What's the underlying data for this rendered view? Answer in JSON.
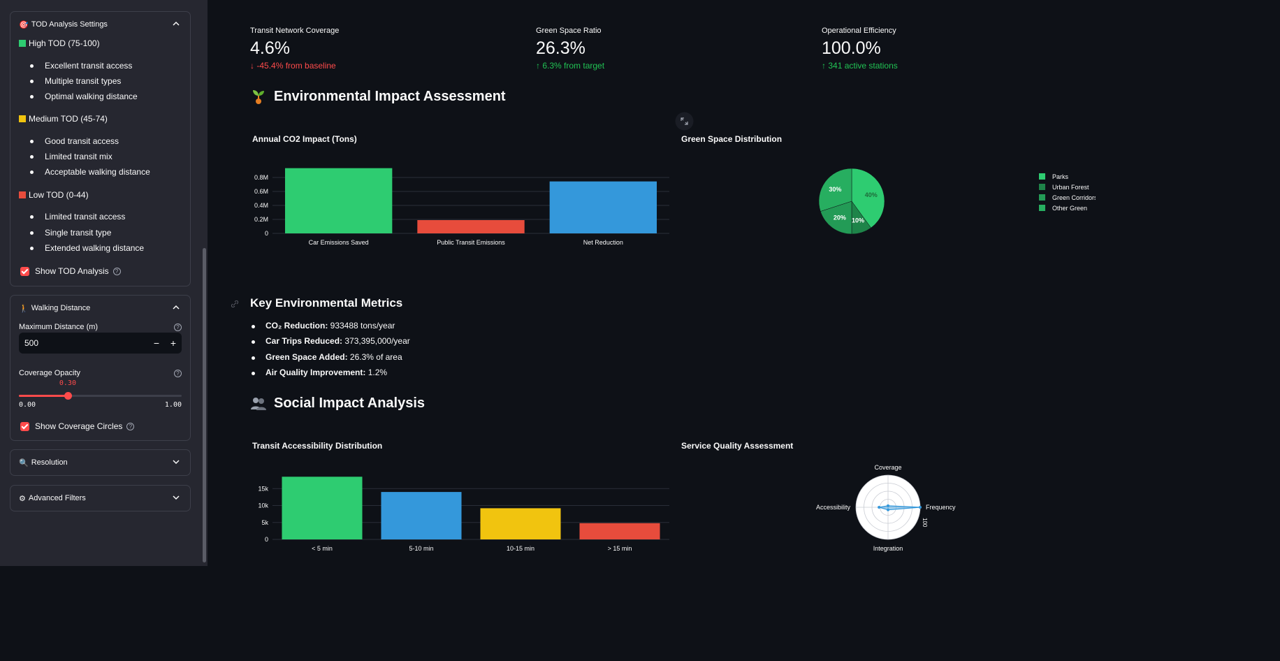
{
  "sidebar": {
    "tod_panel": {
      "title": "TOD Analysis Settings",
      "emoji": "🎯",
      "high": {
        "label": "High TOD (75-100)",
        "color": "#2ecc71",
        "items": [
          "Excellent transit access",
          "Multiple transit types",
          "Optimal walking distance"
        ]
      },
      "medium": {
        "label": "Medium TOD (45-74)",
        "color": "#f1c40f",
        "items": [
          "Good transit access",
          "Limited transit mix",
          "Acceptable walking distance"
        ]
      },
      "low": {
        "label": "Low TOD (0-44)",
        "color": "#e74c3c",
        "items": [
          "Limited transit access",
          "Single transit type",
          "Extended walking distance"
        ]
      },
      "show_checkbox": "Show TOD Analysis"
    },
    "walk_panel": {
      "title": "Walking Distance",
      "emoji": "🚶",
      "max_label": "Maximum Distance (m)",
      "max_value": "500",
      "minus": "−",
      "plus": "+",
      "opacity_label": "Coverage Opacity",
      "opacity_value": "0.30",
      "opacity_min": "0.00",
      "opacity_max": "1.00",
      "opacity_fraction": 0.3,
      "show_checkbox": "Show Coverage Circles"
    },
    "resolution_panel": {
      "title": "Resolution",
      "emoji": "🔍"
    },
    "filters_panel": {
      "title": "Advanced Filters",
      "emoji": "⚙"
    },
    "help_glyph": "?"
  },
  "metrics": [
    {
      "label": "Transit Network Coverage",
      "value": "4.6%",
      "delta": "-45.4% from baseline",
      "arrow": "↓",
      "color": "#ff4b4b"
    },
    {
      "label": "Green Space Ratio",
      "value": "26.3%",
      "delta": "6.3% from target",
      "arrow": "↑",
      "color": "#21c354"
    },
    {
      "label": "Operational Efficiency",
      "value": "100.0%",
      "delta": "341 active stations",
      "arrow": "↑",
      "color": "#21c354"
    }
  ],
  "env_heading": {
    "emoji": "🌱",
    "text": "Environmental Impact Assessment"
  },
  "key_heading": "Key Environmental Metrics",
  "key_metrics": [
    {
      "label": "CO₂ Reduction:",
      "value": " 933488 tons/year"
    },
    {
      "label": "Car Trips Reduced:",
      "value": " 373,395,000/year"
    },
    {
      "label": "Green Space Added:",
      "value": " 26.3% of area"
    },
    {
      "label": "Air Quality Improvement:",
      "value": " 1.2%"
    }
  ],
  "social_heading": {
    "emoji": "👥",
    "text": "Social Impact Analysis"
  },
  "chart_data": [
    {
      "type": "bar",
      "title": "Annual CO2 Impact (Tons)",
      "categories": [
        "Car Emissions Saved",
        "Public Transit Emissions",
        "Net Reduction"
      ],
      "values": [
        933488,
        190000,
        743488
      ],
      "colors": [
        "#2ecc71",
        "#e74c3c",
        "#3498db"
      ],
      "ylim": [
        0,
        1000000
      ],
      "yticks": [
        0,
        200000,
        400000,
        600000,
        800000
      ],
      "ytick_labels": [
        "0",
        "0.2M",
        "0.4M",
        "0.6M",
        "0.8M"
      ]
    },
    {
      "type": "pie",
      "title": "Green Space Distribution",
      "labels": [
        "Parks",
        "Urban Forest",
        "Green Corridors",
        "Other Green"
      ],
      "values": [
        40,
        10,
        20,
        30
      ],
      "value_labels": [
        "40%",
        "10%",
        "20%",
        "30%"
      ],
      "colors": [
        "#2ecc71",
        "#1e8449",
        "#239b56",
        "#27ae60"
      ],
      "legend_placement": "right"
    },
    {
      "type": "bar",
      "title": "Transit Accessibility Distribution",
      "categories": [
        "< 5 min",
        "5-10 min",
        "10-15 min",
        "> 15 min"
      ],
      "values": [
        18500,
        14000,
        9200,
        4800
      ],
      "colors": [
        "#2ecc71",
        "#3498db",
        "#f1c40f",
        "#e74c3c"
      ],
      "ylim": [
        0,
        20000
      ],
      "yticks": [
        0,
        5000,
        10000,
        15000
      ],
      "ytick_labels": [
        "0",
        "5k",
        "10k",
        "15k"
      ]
    },
    {
      "type": "radar",
      "title": "Service Quality Assessment",
      "axes": [
        "Coverage",
        "Frequency",
        "Integration",
        "Accessibility"
      ],
      "values": [
        4.6,
        100,
        8,
        28
      ],
      "range": [
        0,
        100
      ],
      "range_label": "100",
      "color": "#3498db"
    }
  ]
}
